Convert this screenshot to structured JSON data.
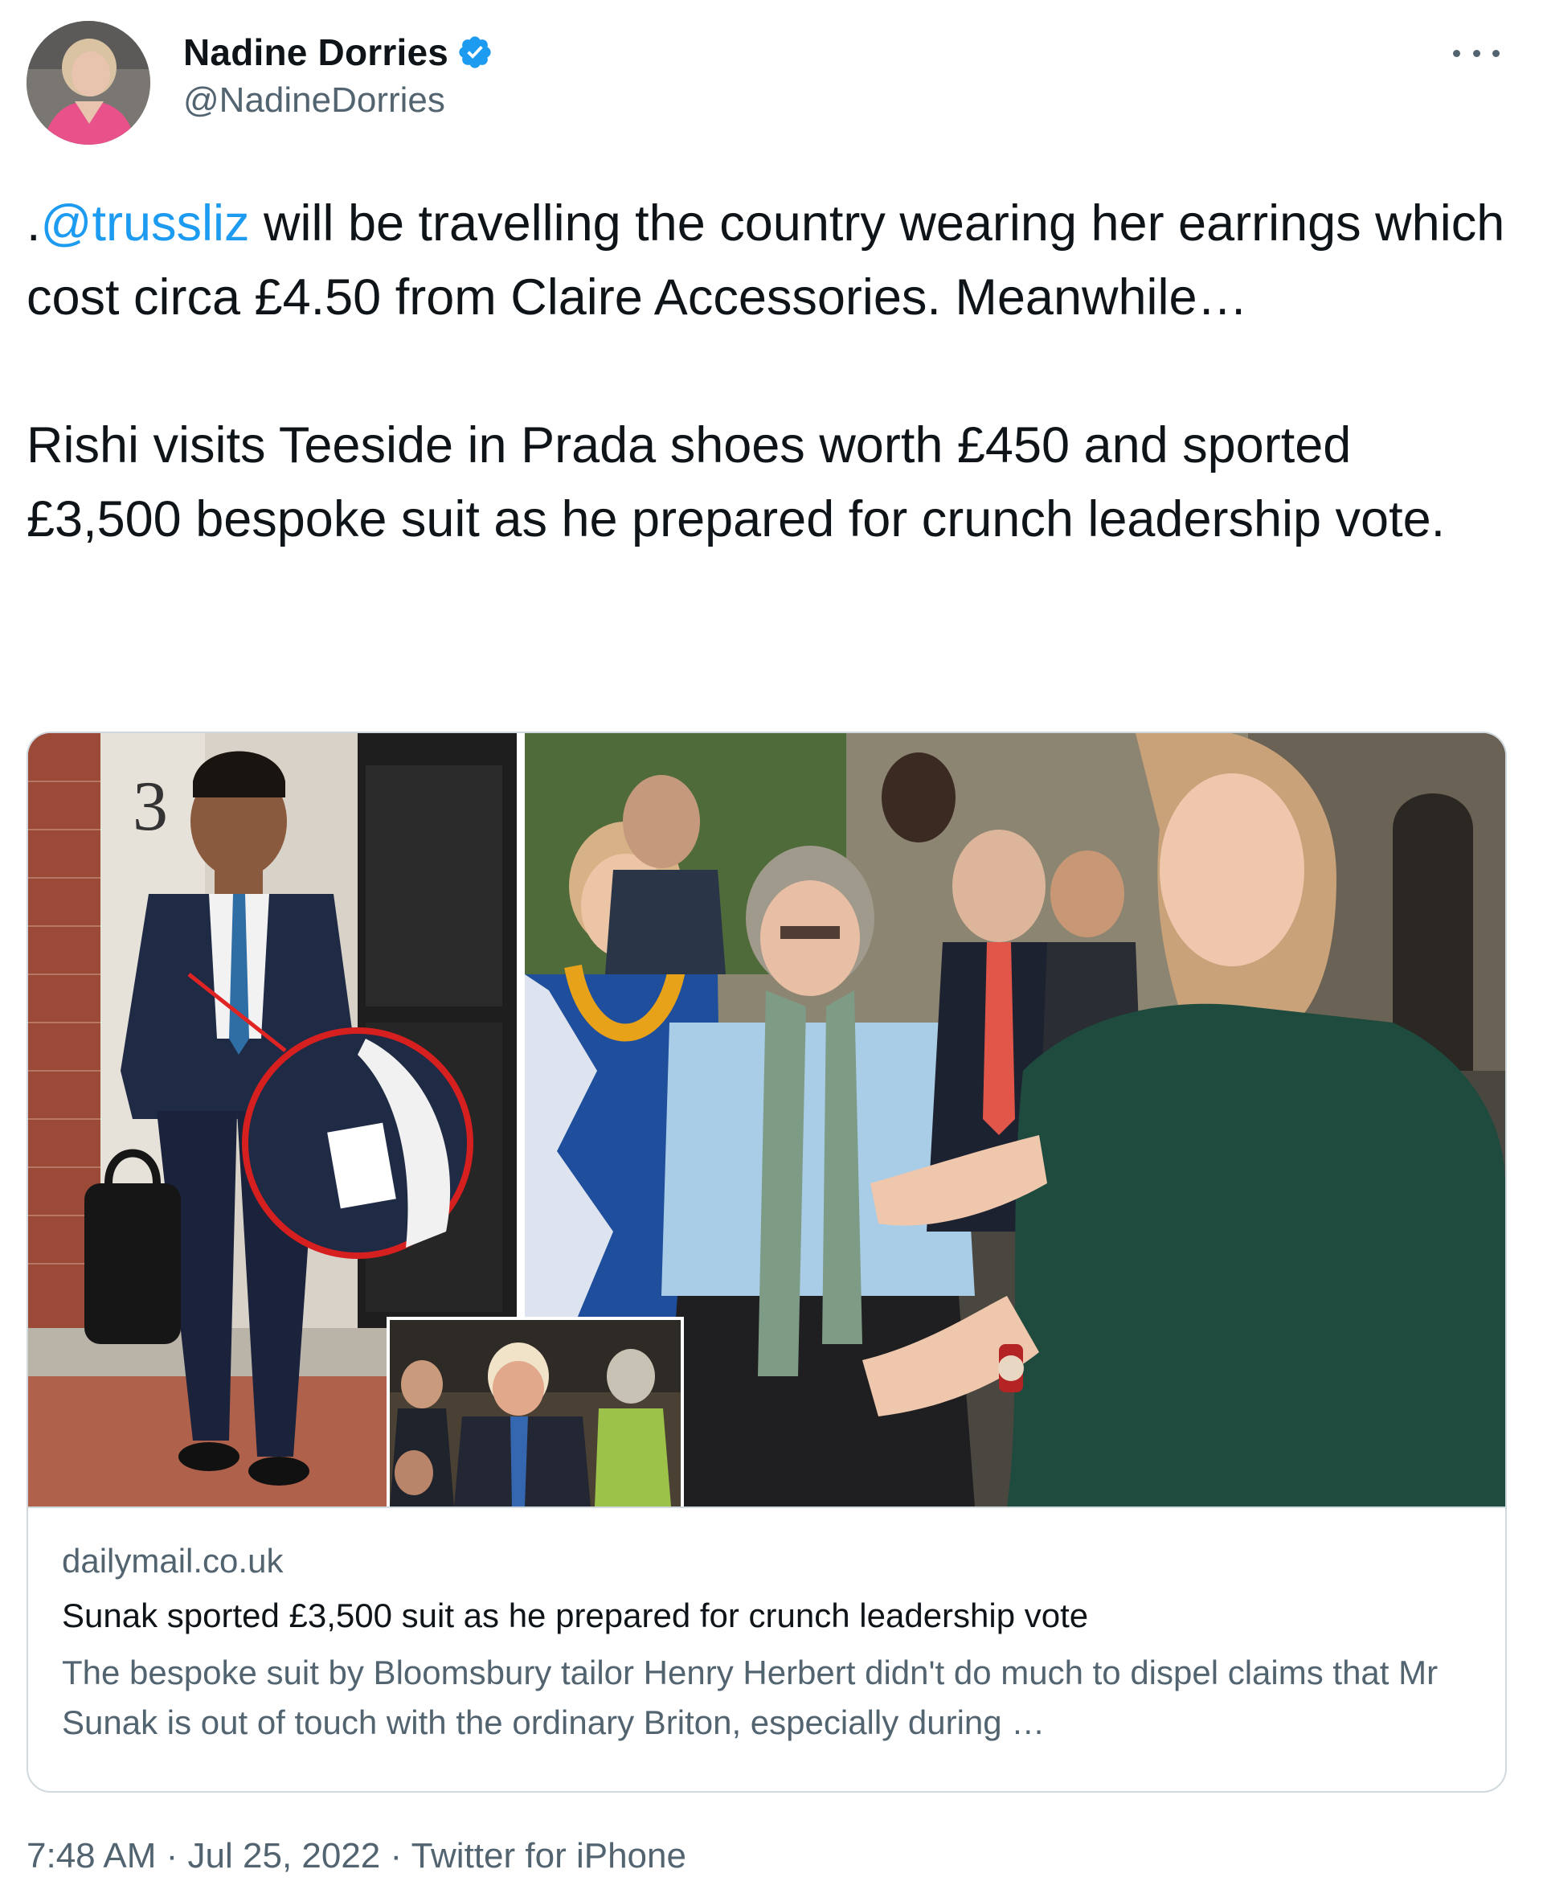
{
  "author": {
    "display_name": "Nadine Dorries",
    "handle": "@NadineDorries",
    "verified": true
  },
  "tweet": {
    "line1_prefix": ".",
    "mention": "@trussliz",
    "line1_rest": " will be travelling the country wearing her earrings which cost circa £4.50 from Claire Accessories. Meanwhile…",
    "paragraph2": "Rishi visits Teeside in Prada shoes worth £450 and sported £3,500 bespoke suit as he prepared for crunch leadership vote."
  },
  "card": {
    "domain": "dailymail.co.uk",
    "title": "Sunak sported £3,500 suit as he prepared for crunch leadership vote",
    "description": "The bespoke suit by Bloomsbury tailor Henry Herbert didn't do much to dispel claims that Mr Sunak is out of touch with the ordinary Briton, especially during …",
    "media_house_number": "3"
  },
  "meta": {
    "timestamp": "7:48 AM · Jul 25, 2022 · Twitter for iPhone"
  },
  "colors": {
    "link": "#1d9bf0",
    "text": "#0f1419",
    "secondary": "#536471",
    "border": "#cfd9de"
  },
  "icons": {
    "verified": "verified-badge-icon",
    "more": "more-options-icon"
  }
}
